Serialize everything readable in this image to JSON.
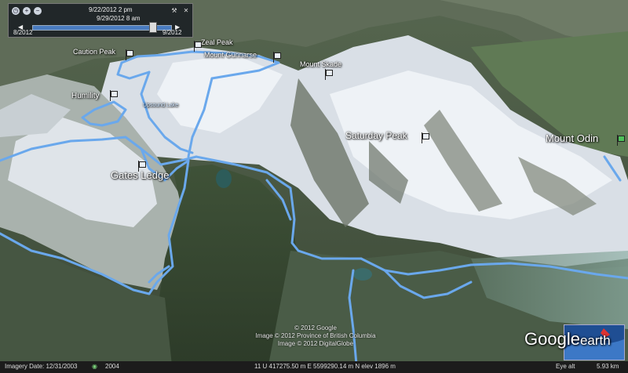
{
  "window": {
    "title": "Google Earth"
  },
  "map_type": "3D satellite terrain view with GPS tracks",
  "colors": {
    "track": "#6aa8ec",
    "label": "#ffffff",
    "snow": "#eef2f6",
    "rock": "#4b5a4a"
  },
  "time_slider": {
    "range_label": "9/22/2012   2 pm",
    "current_label": "9/29/2012   8 am",
    "start_label": "8/2012",
    "end_label": "9/2012",
    "position": 0.86,
    "buttons": {
      "settings_icon": "wrench-icon",
      "zoom_in_icon": "magnifier-plus-icon",
      "zoom_out_icon": "magnifier-minus-icon",
      "clock_icon": "clock-icon"
    }
  },
  "placemarks": [
    {
      "name": "Caution Peak",
      "flag": "white"
    },
    {
      "name": "Zeal Peak",
      "flag": "white"
    },
    {
      "name": "Mount Gunnarse",
      "flag": "white"
    },
    {
      "name": "Mount Skade",
      "flag": "white"
    },
    {
      "name": "Humility",
      "flag": "white"
    },
    {
      "name": "Upsound Lake",
      "flag": "none"
    },
    {
      "name": "Saturday Peak",
      "flag": "white"
    },
    {
      "name": "Mount Odin",
      "flag": "green"
    },
    {
      "name": "Gates Ledge",
      "flag": "white"
    }
  ],
  "credits": {
    "line1": "© 2012 Google",
    "line2": "Image © 2012 Province of British Columbia",
    "line3": "Image © 2012 DigitalGlobe"
  },
  "logo": {
    "google": "Google",
    "earth": "earth"
  },
  "status_bar": {
    "imagery_date": "Imagery Date: 12/31/2003",
    "year_badge": "2004",
    "coordinates": "11 U 417275.50 m E 5599290.14 m N elev  1896 m",
    "eye_alt_label": "Eye alt",
    "eye_alt_value": "5.93 km"
  }
}
